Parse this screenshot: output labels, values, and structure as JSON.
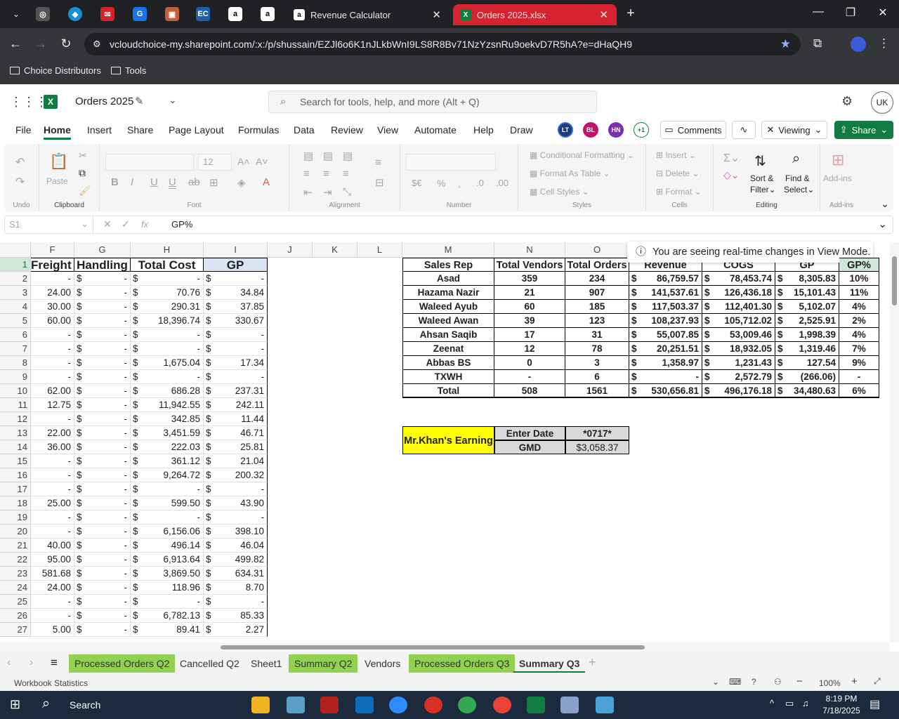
{
  "browser": {
    "tabs": [
      {
        "title": "Revenue Calculator"
      },
      {
        "title": "Orders 2025.xlsx"
      }
    ],
    "url": "vcloudchoice-my.sharepoint.com/:x:/p/shussain/EZJl6o6K1nJLkbWnI9LS8R8Bv71NzYzsnRu9oekvD7R5hA?e=dHaQH9",
    "bookmarks": [
      "Choice Distributors",
      "Tools"
    ]
  },
  "excel": {
    "file_title": "Orders 2025",
    "search_placeholder": "Search for tools, help, and more (Alt + Q)",
    "user_initials": "UK",
    "menu": [
      "File",
      "Home",
      "Insert",
      "Share",
      "Page Layout",
      "Formulas",
      "Data",
      "Review",
      "View",
      "Automate",
      "Help",
      "Draw"
    ],
    "collaborators": [
      "LT",
      "BL",
      "HN",
      "+1"
    ],
    "comments_label": "Comments",
    "viewing_label": "Viewing",
    "share_label": "Share",
    "ribbon": {
      "undo_label": "Undo",
      "paste_label": "Paste",
      "clipboard_label": "Clipboard",
      "font_label": "Font",
      "font_size": "12",
      "alignment_label": "Alignment",
      "number_label": "Number",
      "conditional_formatting": "Conditional Formatting",
      "format_as_table": "Format As Table",
      "cell_styles": "Cell Styles",
      "styles_label": "Styles",
      "insert": "Insert",
      "delete": "Delete",
      "format": "Format",
      "cells_label": "Cells",
      "sort_filter_1": "Sort &",
      "sort_filter_2": "Filter",
      "find_select_1": "Find &",
      "find_select_2": "Select",
      "editing_label": "Editing",
      "addins": "Add-ins",
      "addins_label": "Add-ins"
    },
    "namebox": "S1",
    "formula": "GP%",
    "toast": "You are seeing real-time changes in View Mode.",
    "columns": [
      "F",
      "G",
      "H",
      "I",
      "J",
      "K",
      "L",
      "M",
      "N",
      "O"
    ],
    "rows": [
      "1",
      "2",
      "3",
      "4",
      "5",
      "6",
      "7",
      "8",
      "9",
      "10",
      "11",
      "12",
      "13",
      "14",
      "15",
      "16",
      "17",
      "18",
      "19",
      "20",
      "21",
      "22",
      "23",
      "24",
      "25",
      "26",
      "27"
    ],
    "left_headers": [
      "Freight",
      "Handling",
      "Total Cost",
      "GP"
    ],
    "left_rows": [
      [
        "-",
        "-",
        "-",
        "-"
      ],
      [
        "24.00",
        "-",
        "70.76",
        "34.84"
      ],
      [
        "30.00",
        "-",
        "290.31",
        "37.85"
      ],
      [
        "60.00",
        "-",
        "18,396.74",
        "330.67"
      ],
      [
        "-",
        "-",
        "-",
        "-"
      ],
      [
        "-",
        "-",
        "-",
        "-"
      ],
      [
        "-",
        "-",
        "1,675.04",
        "17.34"
      ],
      [
        "-",
        "-",
        "-",
        "-"
      ],
      [
        "62.00",
        "-",
        "686.28",
        "237.31"
      ],
      [
        "12.75",
        "-",
        "11,942.55",
        "242.11"
      ],
      [
        "-",
        "-",
        "342.85",
        "11.44"
      ],
      [
        "22.00",
        "-",
        "3,451.59",
        "46.71"
      ],
      [
        "36.00",
        "-",
        "222.03",
        "25.81"
      ],
      [
        "-",
        "-",
        "361.12",
        "21.04"
      ],
      [
        "-",
        "-",
        "9,264.72",
        "200.32"
      ],
      [
        "-",
        "-",
        "-",
        "-"
      ],
      [
        "25.00",
        "-",
        "599.50",
        "43.90"
      ],
      [
        "-",
        "-",
        "-",
        "-"
      ],
      [
        "-",
        "-",
        "6,156.06",
        "398.10"
      ],
      [
        "40.00",
        "-",
        "496.14",
        "46.04"
      ],
      [
        "95.00",
        "-",
        "6,913.64",
        "499.82"
      ],
      [
        "581.68",
        "-",
        "3,869.50",
        "634.31"
      ],
      [
        "24.00",
        "-",
        "118.96",
        "8.70"
      ],
      [
        "-",
        "-",
        "-",
        "-"
      ],
      [
        "-",
        "-",
        "6,782.13",
        "85.33"
      ],
      [
        "5.00",
        "-",
        "89.41",
        "2.27"
      ]
    ],
    "summary_headers": [
      "Sales Rep",
      "Total Vendors",
      "Total Orders",
      "Revenue",
      "COGS",
      "GP",
      "GP%"
    ],
    "summary_rows": [
      [
        "Asad",
        "359",
        "234",
        "86,759.57",
        "78,453.74",
        "8,305.83",
        "10%"
      ],
      [
        "Hazama Nazir",
        "21",
        "907",
        "141,537.61",
        "126,436.18",
        "15,101.43",
        "11%"
      ],
      [
        "Waleed Ayub",
        "60",
        "185",
        "117,503.37",
        "112,401.30",
        "5,102.07",
        "4%"
      ],
      [
        "Waleed Awan",
        "39",
        "123",
        "108,237.93",
        "105,712.02",
        "2,525.91",
        "2%"
      ],
      [
        "Ahsan Saqib",
        "17",
        "31",
        "55,007.85",
        "53,009.46",
        "1,998.39",
        "4%"
      ],
      [
        "Zeenat",
        "12",
        "78",
        "20,251.51",
        "18,932.05",
        "1,319.46",
        "7%"
      ],
      [
        "Abbas BS",
        "0",
        "3",
        "1,358.97",
        "1,231.43",
        "127.54",
        "9%"
      ],
      [
        "TXWH",
        "-",
        "6",
        "-",
        "2,572.79",
        "(266.06)",
        "-"
      ],
      [
        "Total",
        "508",
        "1561",
        "530,656.81",
        "496,176.18",
        "34,480.63",
        "6%"
      ]
    ],
    "earning": {
      "label": "Mr.Khan's Earning",
      "date_label": "Enter Date",
      "date_value": "*0717*",
      "gmd_label": "GMD",
      "gmd_value": "$3,058.37"
    },
    "sheets": [
      "Processed Orders Q2",
      "Cancelled Q2",
      "Sheet1",
      "Summary Q2",
      "Vendors",
      "Processed Orders Q3",
      "Summary Q3"
    ],
    "status_left": "Workbook Statistics",
    "zoom": "100%"
  },
  "taskbar": {
    "search": "Search",
    "time": "8:19 PM",
    "date": "7/18/2025"
  },
  "colors": {
    "excel_green": "#107c41",
    "sheet_green": "#92d050",
    "header_yellow": "#ffff00",
    "gray_fill": "#d9d9d9"
  }
}
